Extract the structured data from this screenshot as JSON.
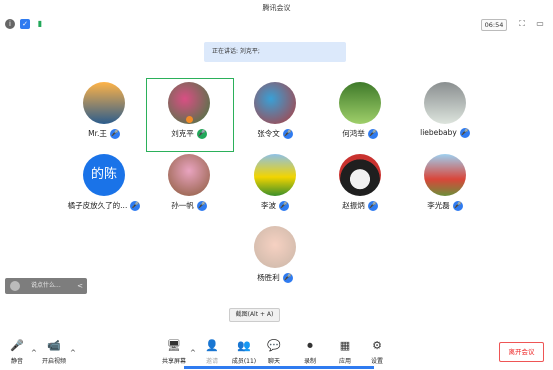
{
  "window": {
    "title": "腾讯会议"
  },
  "status": {
    "timer": "06:54"
  },
  "banner": {
    "speaking": "正在讲话: 刘克平;"
  },
  "participants": [
    {
      "name": "Mr.王",
      "mic": "on",
      "colors": [
        "#ffb347",
        "#2c5c8c"
      ]
    },
    {
      "name": "刘克平",
      "mic": "speaking",
      "colors": [
        "#d94f84",
        "#3c7a3c"
      ]
    },
    {
      "name": "张令文",
      "mic": "on",
      "colors": [
        "#39a0d6",
        "#b33a3a"
      ]
    },
    {
      "name": "何鸿举",
      "mic": "on",
      "colors": [
        "#3f7a2a",
        "#9fcf6a"
      ]
    },
    {
      "name": "liebebaby",
      "mic": "on",
      "colors": [
        "#8a8f90",
        "#dde4dd"
      ]
    },
    {
      "name": "橘子皮放久了的...",
      "mic": "on",
      "avatar_text": "的陈",
      "colors": [
        "#1a73e8",
        "#1a73e8"
      ]
    },
    {
      "name": "孙一帆",
      "mic": "on",
      "colors": [
        "#e9a4c0",
        "#8b5a3a"
      ]
    },
    {
      "name": "李波",
      "mic": "on",
      "colors": [
        "#f2d400",
        "#3c8f2a"
      ]
    },
    {
      "name": "赵振炳",
      "mic": "on",
      "colors": [
        "#1f1f1f",
        "#c9322f"
      ]
    },
    {
      "name": "李光磊",
      "mic": "on",
      "colors": [
        "#d9463a",
        "#9ed0f0"
      ]
    },
    {
      "name": "杨胜利",
      "mic": "on",
      "colors": [
        "#f6d1c2",
        "#c9b6a7"
      ]
    }
  ],
  "chat_overlay": {
    "placeholder": "说点什么...",
    "button": "<"
  },
  "tooltip": {
    "text": "截图(Alt + A)"
  },
  "toolbar": {
    "mute": "静音",
    "video": "开启视频",
    "share": "共享屏幕",
    "invite": "邀请",
    "members": "成员(11)",
    "chat": "聊天",
    "record": "录制",
    "apps": "应用",
    "settings": "设置",
    "leave": "离开会议"
  },
  "icons": {
    "info": "info-icon",
    "shield": "shield-icon",
    "signal": "signal-icon",
    "fullscreen": "fullscreen-icon",
    "layout": "layout-icon"
  }
}
